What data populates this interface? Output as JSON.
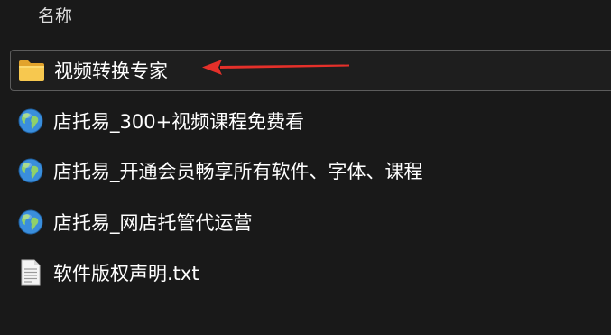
{
  "header": {
    "name_column": "名称"
  },
  "files": [
    {
      "name": "视频转换专家",
      "icon": "folder-icon",
      "selected": true
    },
    {
      "name": "店托易_300+视频课程免费看",
      "icon": "internet-shortcut-icon"
    },
    {
      "name": "店托易_开通会员畅享所有软件、字体、课程",
      "icon": "internet-shortcut-icon"
    },
    {
      "name": "店托易_网店托管代运营",
      "icon": "internet-shortcut-icon"
    },
    {
      "name": "软件版权声明.txt",
      "icon": "text-file-icon"
    }
  ],
  "colors": {
    "background": "#191919",
    "selection_border": "#5c5c5c",
    "arrow": "#e5302a",
    "folder": "#f2c14b"
  }
}
